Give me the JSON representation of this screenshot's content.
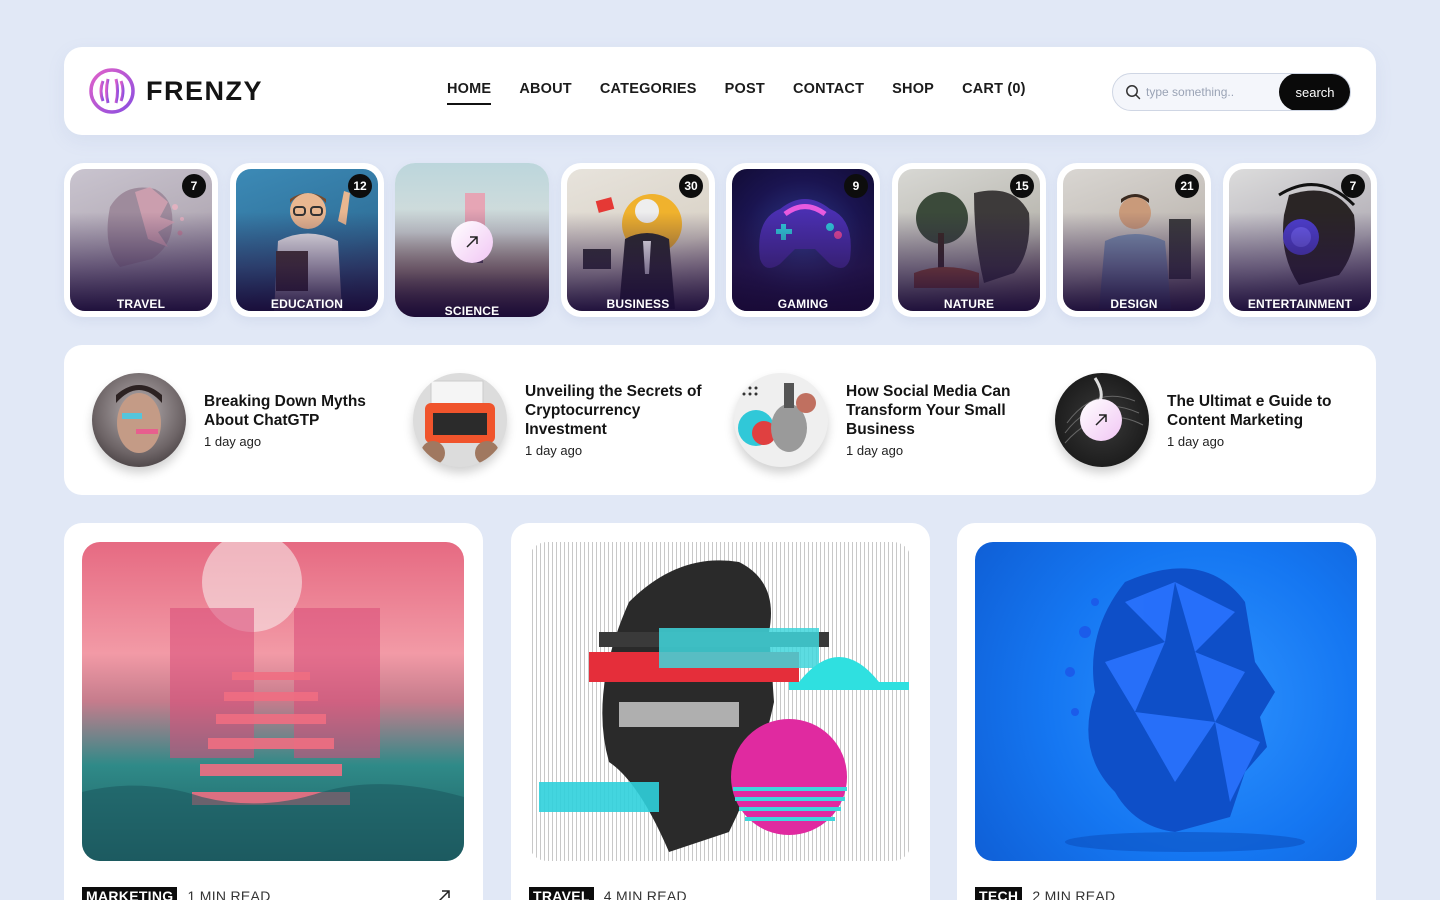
{
  "brand": {
    "name": "FRENZY"
  },
  "nav": [
    {
      "label": "HOME",
      "active": true
    },
    {
      "label": "ABOUT"
    },
    {
      "label": "CATEGORIES"
    },
    {
      "label": "POST"
    },
    {
      "label": "CONTACT"
    },
    {
      "label": "SHOP"
    },
    {
      "label": "CART (0)"
    }
  ],
  "search": {
    "placeholder": "type something..",
    "button": "search"
  },
  "categories": [
    {
      "label": "TRAVEL",
      "count": "7"
    },
    {
      "label": "EDUCATION",
      "count": "12"
    },
    {
      "label": "SCIENCE",
      "count": ""
    },
    {
      "label": "BUSINESS",
      "count": "30"
    },
    {
      "label": "GAMING",
      "count": "9"
    },
    {
      "label": "NATURE",
      "count": "15"
    },
    {
      "label": "DESIGN",
      "count": "21"
    },
    {
      "label": "ENTERTAINMENT",
      "count": "7"
    }
  ],
  "trending": [
    {
      "title": "Breaking Down Myths About ChatGTP",
      "time": "1 day ago"
    },
    {
      "title": "Unveiling the Secrets of Cryptocurrency Investment",
      "time": "1 day ago"
    },
    {
      "title": "How Social Media Can Transform Your Small Business",
      "time": "1 day ago"
    },
    {
      "title": "The Ultimat e Guide to Content Marketing",
      "time": "1 day ago"
    }
  ],
  "posts": [
    {
      "tag": "MARKETING",
      "read": "1 MIN READ"
    },
    {
      "tag": "TRAVEL",
      "read": "4 MIN READ"
    },
    {
      "tag": "TECH",
      "read": "2 MIN READ"
    }
  ],
  "colors": {
    "background": "#e1e8f6",
    "accent": "#b85ad8",
    "dark": "#0a0a0a"
  }
}
